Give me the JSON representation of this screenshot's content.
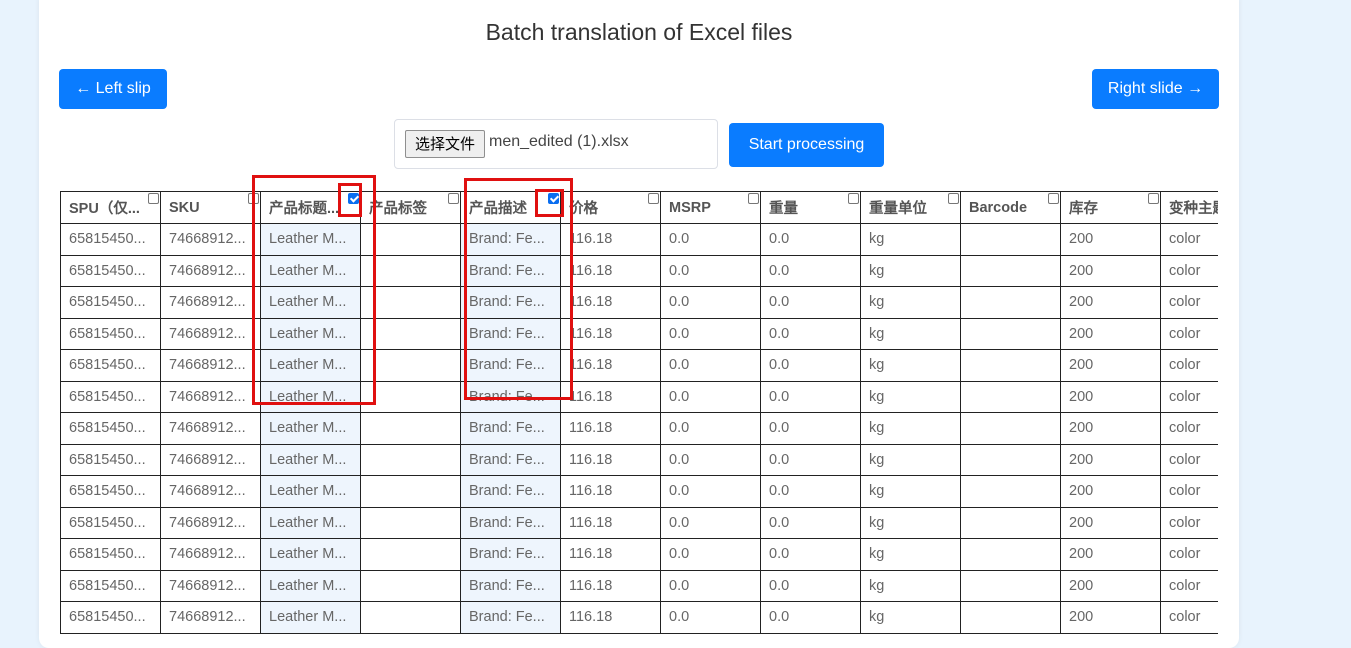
{
  "page": {
    "title": "Batch translation of Excel files",
    "left_button": "← Left slip",
    "right_button": "Right slide →",
    "file_button": "选择文件",
    "file_name": "men_edited (1).xlsx",
    "start_button": "Start processing"
  },
  "colors": {
    "accent": "#0a7cff",
    "highlight_column": "#eef5fd",
    "annotation_red": "#e01010"
  },
  "table": {
    "columns": [
      {
        "label": "SPU（仅...",
        "checked": false,
        "highlight": false
      },
      {
        "label": "SKU",
        "checked": false,
        "highlight": false
      },
      {
        "label": "产品标题...",
        "checked": true,
        "highlight": true
      },
      {
        "label": "产品标签",
        "checked": false,
        "highlight": false
      },
      {
        "label": "产品描述",
        "checked": true,
        "highlight": true
      },
      {
        "label": "价格",
        "checked": false,
        "highlight": false
      },
      {
        "label": "MSRP",
        "checked": false,
        "highlight": false
      },
      {
        "label": "重量",
        "checked": false,
        "highlight": false
      },
      {
        "label": "重量单位",
        "checked": false,
        "highlight": false
      },
      {
        "label": "Barcode",
        "checked": false,
        "highlight": false
      },
      {
        "label": "库存",
        "checked": false,
        "highlight": false
      },
      {
        "label": "变种主题",
        "checked": false,
        "highlight": false
      }
    ],
    "rows": [
      [
        "65815450...",
        "74668912...",
        "Leather M...",
        "",
        "Brand: Fe...",
        "116.18",
        "0.0",
        "0.0",
        "kg",
        "",
        "200",
        "color"
      ],
      [
        "65815450...",
        "74668912...",
        "Leather M...",
        "",
        "Brand: Fe...",
        "116.18",
        "0.0",
        "0.0",
        "kg",
        "",
        "200",
        "color"
      ],
      [
        "65815450...",
        "74668912...",
        "Leather M...",
        "",
        "Brand: Fe...",
        "116.18",
        "0.0",
        "0.0",
        "kg",
        "",
        "200",
        "color"
      ],
      [
        "65815450...",
        "74668912...",
        "Leather M...",
        "",
        "Brand: Fe...",
        "116.18",
        "0.0",
        "0.0",
        "kg",
        "",
        "200",
        "color"
      ],
      [
        "65815450...",
        "74668912...",
        "Leather M...",
        "",
        "Brand: Fe...",
        "116.18",
        "0.0",
        "0.0",
        "kg",
        "",
        "200",
        "color"
      ],
      [
        "65815450...",
        "74668912...",
        "Leather M...",
        "",
        "Brand: Fe...",
        "116.18",
        "0.0",
        "0.0",
        "kg",
        "",
        "200",
        "color"
      ],
      [
        "65815450...",
        "74668912...",
        "Leather M...",
        "",
        "Brand: Fe...",
        "116.18",
        "0.0",
        "0.0",
        "kg",
        "",
        "200",
        "color"
      ],
      [
        "65815450...",
        "74668912...",
        "Leather M...",
        "",
        "Brand: Fe...",
        "116.18",
        "0.0",
        "0.0",
        "kg",
        "",
        "200",
        "color"
      ],
      [
        "65815450...",
        "74668912...",
        "Leather M...",
        "",
        "Brand: Fe...",
        "116.18",
        "0.0",
        "0.0",
        "kg",
        "",
        "200",
        "color"
      ],
      [
        "65815450...",
        "74668912...",
        "Leather M...",
        "",
        "Brand: Fe...",
        "116.18",
        "0.0",
        "0.0",
        "kg",
        "",
        "200",
        "color"
      ],
      [
        "65815450...",
        "74668912...",
        "Leather M...",
        "",
        "Brand: Fe...",
        "116.18",
        "0.0",
        "0.0",
        "kg",
        "",
        "200",
        "color"
      ],
      [
        "65815450...",
        "74668912...",
        "Leather M...",
        "",
        "Brand: Fe...",
        "116.18",
        "0.0",
        "0.0",
        "kg",
        "",
        "200",
        "color"
      ],
      [
        "65815450...",
        "74668912...",
        "Leather M...",
        "",
        "Brand: Fe...",
        "116.18",
        "0.0",
        "0.0",
        "kg",
        "",
        "200",
        "color"
      ]
    ]
  }
}
